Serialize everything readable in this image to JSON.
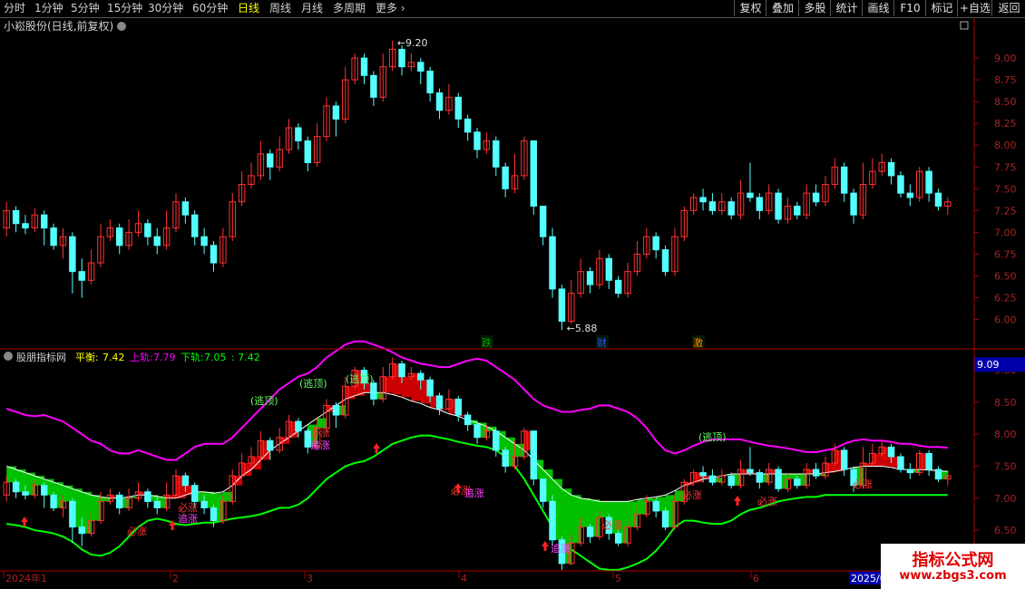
{
  "toolbar": {
    "periods": [
      "分时",
      "1分钟",
      "5分钟",
      "15分钟",
      "30分钟",
      "60分钟",
      "日线",
      "周线",
      "月线",
      "多周期",
      "更多"
    ],
    "active": "日线",
    "buttons": [
      "复权",
      "叠加",
      "多股",
      "统计",
      "画线",
      "F10",
      "标记",
      "+自选",
      "返回"
    ]
  },
  "main_panel": {
    "title": "小崧股份(日线,前复权)",
    "price_axis": [
      "9.00",
      "8.75",
      "8.50",
      "8.25",
      "8.00",
      "7.75",
      "7.50",
      "7.25",
      "7.00",
      "6.75",
      "6.50",
      "6.25",
      "6.00"
    ],
    "high_label": "9.20",
    "low_label": "5.88",
    "markers": [
      "跌",
      "财",
      "激"
    ]
  },
  "indicator_panel": {
    "name": "股朋指标网",
    "ping_label": "平衡:",
    "ping_value": "7.42",
    "up_label": "上轨:",
    "up_value": "7.79",
    "down_label": "下轨:",
    "down_value": "7.05",
    "extra_value": ": 7.42",
    "axis": [
      "9.00",
      "8.50",
      "8.00",
      "7.50",
      "7.00",
      "6.50",
      "6.00"
    ],
    "axis_highlight": "9.09",
    "signals": {
      "escape_top": "(逃顶)",
      "must_rise": "必涨",
      "chase_rise": "追涨"
    }
  },
  "date_axis": [
    "2024年1",
    "2",
    "3",
    "4",
    "5",
    "6",
    "2025/0"
  ],
  "watermark": {
    "title": "指标公式网",
    "url": "www.zbgs3.com"
  },
  "colors": {
    "up": "#ff3232",
    "down": "#54ffff",
    "upper_band": "#ff00ff",
    "lower_band": "#00ff00",
    "fill_red": "#cc0000",
    "fill_green": "#00c000"
  },
  "chart_data": {
    "type": "candlestick",
    "price_range": [
      5.85,
      9.25
    ],
    "indicator_range": [
      5.95,
      9.15
    ],
    "candles": [
      [
        7.05,
        7.25,
        7.35,
        6.95
      ],
      [
        7.25,
        7.1,
        7.3,
        7.0
      ],
      [
        7.1,
        7.05,
        7.2,
        6.98
      ],
      [
        7.05,
        7.2,
        7.28,
        7.0
      ],
      [
        7.2,
        7.05,
        7.25,
        6.85
      ],
      [
        7.05,
        6.85,
        7.1,
        6.8
      ],
      [
        6.85,
        6.95,
        7.05,
        6.7
      ],
      [
        6.95,
        6.55,
        7.0,
        6.3
      ],
      [
        6.55,
        6.45,
        6.7,
        6.25
      ],
      [
        6.45,
        6.65,
        6.8,
        6.4
      ],
      [
        6.65,
        6.95,
        7.1,
        6.6
      ],
      [
        6.95,
        7.05,
        7.15,
        6.9
      ],
      [
        7.05,
        6.85,
        7.1,
        6.75
      ],
      [
        6.85,
        7.0,
        7.15,
        6.8
      ],
      [
        7.0,
        7.1,
        7.25,
        6.95
      ],
      [
        7.1,
        6.95,
        7.15,
        6.85
      ],
      [
        6.95,
        6.85,
        7.05,
        6.75
      ],
      [
        6.85,
        7.05,
        7.25,
        6.8
      ],
      [
        7.05,
        7.35,
        7.45,
        7.0
      ],
      [
        7.35,
        7.2,
        7.4,
        7.1
      ],
      [
        7.2,
        6.95,
        7.25,
        6.85
      ],
      [
        6.95,
        6.85,
        7.05,
        6.75
      ],
      [
        6.85,
        6.65,
        6.9,
        6.55
      ],
      [
        6.65,
        6.95,
        7.05,
        6.6
      ],
      [
        6.95,
        7.35,
        7.45,
        6.9
      ],
      [
        7.35,
        7.55,
        7.7,
        7.3
      ],
      [
        7.55,
        7.65,
        7.8,
        7.5
      ],
      [
        7.65,
        7.9,
        8.05,
        7.6
      ],
      [
        7.9,
        7.75,
        7.95,
        7.6
      ],
      [
        7.75,
        7.95,
        8.1,
        7.7
      ],
      [
        7.95,
        8.2,
        8.3,
        7.9
      ],
      [
        8.2,
        8.05,
        8.25,
        7.95
      ],
      [
        8.05,
        7.8,
        8.1,
        7.7
      ],
      [
        7.8,
        8.1,
        8.25,
        7.75
      ],
      [
        8.1,
        8.45,
        8.55,
        8.05
      ],
      [
        8.45,
        8.3,
        8.5,
        8.1
      ],
      [
        8.3,
        8.75,
        8.9,
        8.25
      ],
      [
        8.75,
        9.0,
        9.05,
        8.7
      ],
      [
        9.0,
        8.8,
        9.05,
        8.7
      ],
      [
        8.8,
        8.55,
        8.85,
        8.45
      ],
      [
        8.55,
        8.9,
        9.05,
        8.5
      ],
      [
        8.9,
        9.1,
        9.2,
        8.85
      ],
      [
        9.1,
        8.9,
        9.15,
        8.8
      ],
      [
        8.9,
        8.95,
        9.05,
        8.85
      ],
      [
        8.95,
        8.85,
        9.0,
        8.7
      ],
      [
        8.85,
        8.6,
        8.9,
        8.5
      ],
      [
        8.6,
        8.4,
        8.65,
        8.3
      ],
      [
        8.4,
        8.55,
        8.7,
        8.35
      ],
      [
        8.55,
        8.3,
        8.6,
        8.2
      ],
      [
        8.3,
        8.15,
        8.35,
        8.05
      ],
      [
        8.15,
        7.95,
        8.2,
        7.85
      ],
      [
        7.95,
        8.05,
        8.15,
        7.9
      ],
      [
        8.05,
        7.75,
        8.1,
        7.65
      ],
      [
        7.75,
        7.5,
        7.8,
        7.4
      ],
      [
        7.5,
        7.65,
        7.9,
        7.45
      ],
      [
        7.65,
        8.05,
        8.1,
        7.6
      ],
      [
        8.05,
        7.3,
        8.05,
        7.2
      ],
      [
        7.3,
        6.95,
        7.3,
        6.85
      ],
      [
        6.95,
        6.35,
        7.05,
        6.25
      ],
      [
        6.35,
        5.98,
        6.4,
        5.88
      ],
      [
        5.98,
        6.3,
        6.45,
        5.95
      ],
      [
        6.3,
        6.55,
        6.7,
        6.25
      ],
      [
        6.55,
        6.4,
        6.6,
        6.3
      ],
      [
        6.4,
        6.7,
        6.8,
        6.35
      ],
      [
        6.7,
        6.45,
        6.75,
        6.35
      ],
      [
        6.45,
        6.3,
        6.5,
        6.25
      ],
      [
        6.3,
        6.55,
        6.65,
        6.25
      ],
      [
        6.55,
        6.75,
        6.9,
        6.5
      ],
      [
        6.75,
        6.95,
        7.05,
        6.7
      ],
      [
        6.95,
        6.8,
        7.0,
        6.7
      ],
      [
        6.8,
        6.55,
        6.85,
        6.5
      ],
      [
        6.55,
        6.95,
        7.05,
        6.5
      ],
      [
        6.95,
        7.25,
        7.3,
        6.9
      ],
      [
        7.25,
        7.4,
        7.45,
        7.2
      ],
      [
        7.4,
        7.35,
        7.5,
        7.25
      ],
      [
        7.35,
        7.25,
        7.45,
        7.2
      ],
      [
        7.25,
        7.35,
        7.45,
        7.2
      ],
      [
        7.35,
        7.2,
        7.4,
        7.15
      ],
      [
        7.2,
        7.45,
        7.6,
        7.15
      ],
      [
        7.45,
        7.4,
        7.8,
        7.35
      ],
      [
        7.4,
        7.25,
        7.45,
        7.15
      ],
      [
        7.25,
        7.45,
        7.55,
        7.2
      ],
      [
        7.45,
        7.15,
        7.5,
        7.1
      ],
      [
        7.15,
        7.3,
        7.4,
        7.1
      ],
      [
        7.3,
        7.2,
        7.35,
        7.15
      ],
      [
        7.2,
        7.45,
        7.55,
        7.15
      ],
      [
        7.45,
        7.35,
        7.55,
        7.3
      ],
      [
        7.35,
        7.55,
        7.65,
        7.3
      ],
      [
        7.55,
        7.75,
        7.85,
        7.5
      ],
      [
        7.75,
        7.45,
        7.8,
        7.35
      ],
      [
        7.45,
        7.2,
        7.5,
        7.1
      ],
      [
        7.2,
        7.55,
        7.8,
        7.15
      ],
      [
        7.55,
        7.7,
        7.85,
        7.5
      ],
      [
        7.7,
        7.8,
        7.9,
        7.65
      ],
      [
        7.8,
        7.65,
        7.85,
        7.55
      ],
      [
        7.65,
        7.45,
        7.7,
        7.4
      ],
      [
        7.45,
        7.4,
        7.55,
        7.3
      ],
      [
        7.4,
        7.7,
        7.75,
        7.35
      ],
      [
        7.7,
        7.45,
        7.75,
        7.35
      ],
      [
        7.45,
        7.3,
        7.5,
        7.25
      ],
      [
        7.3,
        7.35,
        7.4,
        7.2
      ]
    ],
    "upper_band_series": [
      8.4,
      8.35,
      8.3,
      8.28,
      8.3,
      8.25,
      8.2,
      8.1,
      8.0,
      7.9,
      7.85,
      7.75,
      7.7,
      7.7,
      7.75,
      7.7,
      7.65,
      7.6,
      7.6,
      7.7,
      7.8,
      7.85,
      7.85,
      7.85,
      7.95,
      8.1,
      8.25,
      8.4,
      8.55,
      8.7,
      8.8,
      8.9,
      8.95,
      9.05,
      9.2,
      9.3,
      9.4,
      9.45,
      9.45,
      9.4,
      9.35,
      9.28,
      9.2,
      9.15,
      9.1,
      9.08,
      9.05,
      9.05,
      9.1,
      9.15,
      9.18,
      9.15,
      9.05,
      8.95,
      8.85,
      8.7,
      8.55,
      8.45,
      8.4,
      8.35,
      8.35,
      8.38,
      8.4,
      8.45,
      8.45,
      8.4,
      8.35,
      8.25,
      8.1,
      7.9,
      7.75,
      7.7,
      7.75,
      7.82,
      7.88,
      7.92,
      7.92,
      7.92,
      7.92,
      7.88,
      7.85,
      7.82,
      7.8,
      7.78,
      7.75,
      7.72,
      7.72,
      7.75,
      7.78,
      7.85,
      7.9,
      7.92,
      7.9,
      7.9,
      7.88,
      7.85,
      7.85,
      7.82,
      7.8,
      7.8,
      7.79
    ],
    "lower_band_series": [
      6.6,
      6.58,
      6.55,
      6.5,
      6.48,
      6.45,
      6.4,
      6.32,
      6.2,
      6.12,
      6.1,
      6.15,
      6.25,
      6.4,
      6.55,
      6.65,
      6.68,
      6.65,
      6.6,
      6.58,
      6.6,
      6.62,
      6.62,
      6.65,
      6.68,
      6.7,
      6.72,
      6.75,
      6.8,
      6.85,
      6.85,
      6.9,
      7.0,
      7.15,
      7.3,
      7.4,
      7.5,
      7.55,
      7.58,
      7.65,
      7.75,
      7.85,
      7.9,
      7.95,
      7.98,
      7.98,
      7.95,
      7.92,
      7.88,
      7.85,
      7.82,
      7.8,
      7.75,
      7.65,
      7.5,
      7.3,
      7.05,
      6.8,
      6.55,
      6.35,
      6.2,
      6.1,
      6.0,
      5.9,
      5.88,
      5.88,
      5.92,
      5.98,
      6.05,
      6.18,
      6.35,
      6.55,
      6.65,
      6.65,
      6.62,
      6.6,
      6.6,
      6.65,
      6.75,
      6.82,
      6.85,
      6.9,
      6.95,
      6.98,
      7.0,
      7.02,
      7.02,
      7.05,
      7.05,
      7.05,
      7.05,
      7.05,
      7.05,
      7.05,
      7.05,
      7.05,
      7.05,
      7.05,
      7.05,
      7.05,
      7.05
    ],
    "balance_series": [
      7.5,
      7.45,
      7.4,
      7.35,
      7.3,
      7.25,
      7.2,
      7.15,
      7.1,
      7.05,
      7.02,
      7.0,
      7.0,
      7.02,
      7.05,
      7.05,
      7.03,
      7.0,
      7.0,
      7.05,
      7.1,
      7.1,
      7.08,
      7.1,
      7.2,
      7.35,
      7.45,
      7.6,
      7.75,
      7.85,
      7.95,
      8.05,
      8.15,
      8.25,
      8.35,
      8.45,
      8.55,
      8.6,
      8.65,
      8.65,
      8.65,
      8.62,
      8.58,
      8.52,
      8.48,
      8.42,
      8.38,
      8.32,
      8.28,
      8.22,
      8.18,
      8.12,
      8.05,
      7.95,
      7.85,
      7.75,
      7.6,
      7.45,
      7.3,
      7.15,
      7.05,
      7.0,
      6.98,
      6.95,
      6.95,
      6.95,
      6.95,
      6.98,
      7.0,
      7.02,
      7.05,
      7.12,
      7.2,
      7.25,
      7.3,
      7.32,
      7.35,
      7.38,
      7.38,
      7.38,
      7.38,
      7.38,
      7.38,
      7.38,
      7.38,
      7.38,
      7.38,
      7.4,
      7.42,
      7.45,
      7.48,
      7.5,
      7.5,
      7.5,
      7.48,
      7.45,
      7.45,
      7.45,
      7.44,
      7.43,
      7.42
    ]
  }
}
